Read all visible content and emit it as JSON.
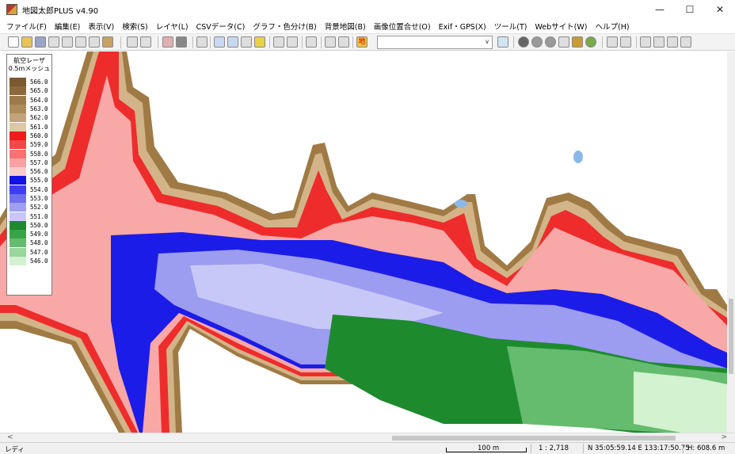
{
  "window": {
    "title": "地図太郎PLUS v4.90",
    "minimize": "—",
    "maximize": "☐",
    "close": "✕"
  },
  "menu": [
    "ファイル(F)",
    "編集(E)",
    "表示(V)",
    "検索(S)",
    "レイヤ(L)",
    "CSVデータ(C)",
    "グラフ・色分け(B)",
    "背景地図(B)",
    "画像位置合せ(O)",
    "Exif・GPS(X)",
    "ツール(T)",
    "Webサイト(W)",
    "ヘルプ(H)"
  ],
  "toolbar": {
    "layer_select_value": "",
    "map_button_glyph": "地"
  },
  "legend": {
    "title_line1": "航空レーザ",
    "title_line2": "0.5mメッシュ",
    "rows": [
      {
        "value": "566.0",
        "color": "#7a5a2e"
      },
      {
        "value": "565.0",
        "color": "#8c6a3c"
      },
      {
        "value": "564.0",
        "color": "#9c7a4a"
      },
      {
        "value": "563.0",
        "color": "#ae8c5a"
      },
      {
        "value": "562.0",
        "color": "#c2a478"
      },
      {
        "value": "561.0",
        "color": "#dcc8a4"
      },
      {
        "value": "560.0",
        "color": "#ee1c1c"
      },
      {
        "value": "559.0",
        "color": "#f44848"
      },
      {
        "value": "558.0",
        "color": "#f77272"
      },
      {
        "value": "557.0",
        "color": "#f9a0a0"
      },
      {
        "value": "556.0",
        "color": "#fbcaca"
      },
      {
        "value": "555.0",
        "color": "#1212e6"
      },
      {
        "value": "554.0",
        "color": "#3e3ef0"
      },
      {
        "value": "553.0",
        "color": "#7070ee"
      },
      {
        "value": "552.0",
        "color": "#9e9ef2"
      },
      {
        "value": "551.0",
        "color": "#c8c8f8"
      },
      {
        "value": "550.0",
        "color": "#1e8a2e"
      },
      {
        "value": "549.0",
        "color": "#38a448"
      },
      {
        "value": "548.0",
        "color": "#66bc6e"
      },
      {
        "value": "547.0",
        "color": "#98d69a"
      },
      {
        "value": "546.0",
        "color": "#d2f2d0"
      }
    ]
  },
  "scrollbars": {
    "left_arrow": "<",
    "right_arrow": ">"
  },
  "status": {
    "ready": "レディ",
    "scale_label": "100 m",
    "ratio": "1 : 2,718",
    "coords": "N 35:05:59.14  E 133:17:50.75",
    "height": "H: 608.6 m"
  }
}
